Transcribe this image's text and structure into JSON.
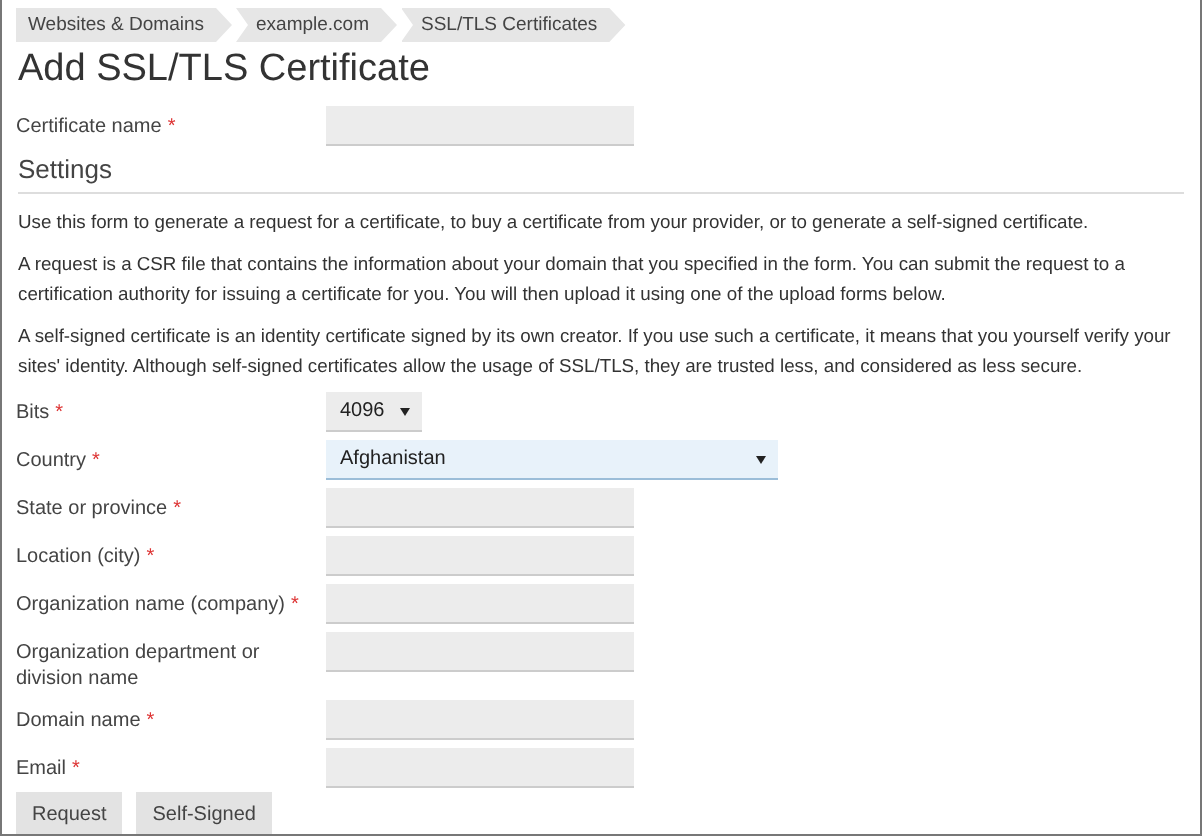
{
  "breadcrumbs": [
    {
      "label": "Websites & Domains"
    },
    {
      "label": "example.com"
    },
    {
      "label": "SSL/TLS Certificates"
    }
  ],
  "title": "Add SSL/TLS Certificate",
  "certificate_field": {
    "label": "Certificate name",
    "required_mark": "*",
    "kind": "text",
    "focused": false
  },
  "section_title": "Settings",
  "paragraphs": [
    "Use this form to generate a request for a certificate, to buy a certificate from your provider, or to generate a self-signed certificate.",
    "A request is a CSR file that contains the information about your domain that you specified in the form. You can submit the request to a certification authority for issuing a certificate for you. You will then upload it using one of the upload forms below.",
    "A self-signed certificate is an identity certificate signed by its own creator. If you use such a certificate, it means that you yourself verify your sites' identity. Although self-signed certificates allow the usage of SSL/TLS, they are trusted less, and considered as less secure."
  ],
  "fields": [
    {
      "label": "Bits",
      "required_mark": "*",
      "kind": "small-select",
      "value": "4096",
      "focused": false
    },
    {
      "label": "Country",
      "required_mark": "*",
      "kind": "select",
      "value": "Afghanistan",
      "focused": true
    },
    {
      "label": "State or province",
      "required_mark": "*",
      "kind": "text",
      "focused": false
    },
    {
      "label": "Location (city)",
      "required_mark": "*",
      "kind": "text",
      "focused": false
    },
    {
      "label": "Organization name (company)",
      "required_mark": "*",
      "kind": "text",
      "focused": false
    },
    {
      "label": "Organization department or division name",
      "kind": "text",
      "focused": false
    },
    {
      "label": "Domain name",
      "required_mark": "*",
      "kind": "text",
      "focused": false
    },
    {
      "label": "Email",
      "required_mark": "*",
      "kind": "text",
      "focused": false
    }
  ],
  "buttons": [
    "Request",
    "Self-Signed"
  ]
}
